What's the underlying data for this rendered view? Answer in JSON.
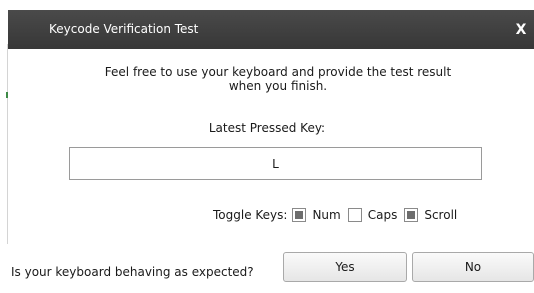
{
  "window": {
    "title": "Keycode Verification Test",
    "close_label": "X"
  },
  "instructions": {
    "line1": "Feel free to use your keyboard and provide the test result",
    "line2": "when you finish."
  },
  "latest_key": {
    "label": "Latest Pressed Key:",
    "value": "L"
  },
  "toggle_keys": {
    "label": "Toggle Keys:",
    "items": [
      {
        "label": "Num",
        "checked": true
      },
      {
        "label": "Caps",
        "checked": false
      },
      {
        "label": "Scroll",
        "checked": true
      }
    ]
  },
  "result": {
    "question": "Is your keyboard behaving as expected?",
    "yes_label": "Yes",
    "no_label": "No"
  },
  "colors": {
    "titlebar": "#404040",
    "checkbox_fill": "#6d6d6d"
  }
}
